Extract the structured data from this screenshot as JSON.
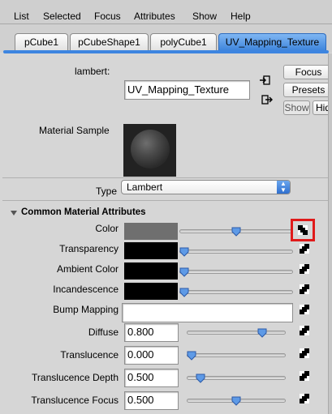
{
  "menu": [
    "List",
    "Selected",
    "Focus",
    "Attributes",
    "Show",
    "Help"
  ],
  "tabs": [
    {
      "label": "pCube1",
      "active": false
    },
    {
      "label": "pCubeShape1",
      "active": false
    },
    {
      "label": "polyCube1",
      "active": false
    },
    {
      "label": "UV_Mapping_Texture",
      "active": true
    }
  ],
  "header": {
    "node_type_label": "lambert:",
    "node_name": "UV_Mapping_Texture",
    "focus_label": "Focus",
    "presets_label": "Presets",
    "show_label": "Show",
    "hide_label": "Hid",
    "material_sample_label": "Material Sample"
  },
  "type_field": {
    "label": "Type",
    "value": "Lambert"
  },
  "section": {
    "title": "Common Material Attributes"
  },
  "attributes": {
    "color": {
      "label": "Color",
      "swatch": "#6f6f6f",
      "slider": 0.5
    },
    "transparency": {
      "label": "Transparency",
      "swatch": "#000000",
      "slider": 0.0
    },
    "ambient": {
      "label": "Ambient Color",
      "swatch": "#000000",
      "slider": 0.0
    },
    "incandescence": {
      "label": "Incandescence",
      "swatch": "#000000",
      "slider": 0.0
    },
    "bump": {
      "label": "Bump Mapping",
      "value": ""
    },
    "diffuse": {
      "label": "Diffuse",
      "value": "0.800",
      "slider": 0.8
    },
    "translucence": {
      "label": "Translucence",
      "value": "0.000",
      "slider": 0.0
    },
    "translucence_depth": {
      "label": "Translucence Depth",
      "value": "0.500",
      "slider": 0.1
    },
    "translucence_focus": {
      "label": "Translucence Focus",
      "value": "0.500",
      "slider": 0.5
    }
  },
  "colors": {
    "accent": "#3f86dc",
    "highlight": "#e01a1a"
  }
}
